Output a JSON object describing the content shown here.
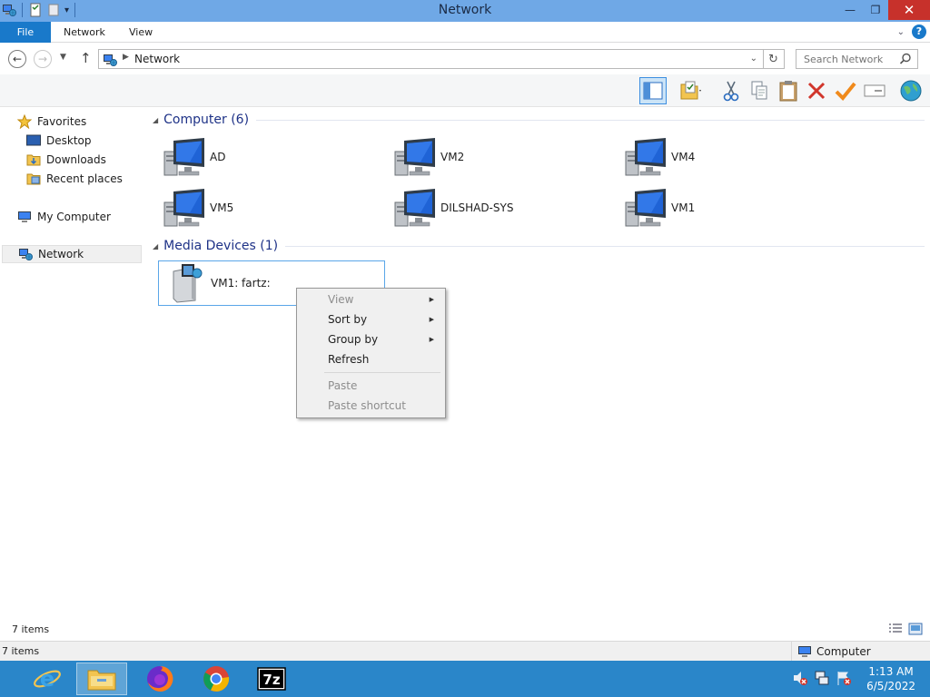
{
  "window": {
    "title": "Network"
  },
  "ribbon": {
    "tabs": [
      "File",
      "Network",
      "View"
    ]
  },
  "navbar": {
    "address_crumb": "Network",
    "search_placeholder": "Search Network"
  },
  "toolbar": {
    "buttons": [
      "preview-pane",
      "properties-folder",
      "cut",
      "copy",
      "paste",
      "delete",
      "apply",
      "rename",
      "network-globe"
    ]
  },
  "navpane": {
    "favorites": "Favorites",
    "favorites_items": [
      "Desktop",
      "Downloads",
      "Recent places"
    ],
    "my_computer": "My Computer",
    "network": "Network"
  },
  "content": {
    "groups": [
      {
        "header": "Computer (6)",
        "items": [
          "AD",
          "VM2",
          "VM4",
          "VM5",
          "DILSHAD-SYS",
          "VM1"
        ]
      },
      {
        "header": "Media Devices (1)",
        "items": [
          "VM1: fartz:"
        ]
      }
    ]
  },
  "context_menu": {
    "items": [
      {
        "label": "View",
        "enabled": false,
        "submenu": true
      },
      {
        "label": "Sort by",
        "enabled": true,
        "submenu": true
      },
      {
        "label": "Group by",
        "enabled": true,
        "submenu": true
      },
      {
        "label": "Refresh",
        "enabled": true,
        "submenu": false
      },
      {
        "label": "Paste",
        "enabled": false,
        "submenu": false
      },
      {
        "label": "Paste shortcut",
        "enabled": false,
        "submenu": false
      }
    ]
  },
  "statusbar": {
    "item_count": "7 items",
    "bottom_count": "7 items",
    "zone": "Computer"
  },
  "taskbar": {
    "apps": [
      "internet-explorer",
      "file-explorer",
      "firefox",
      "chrome",
      "7-zip"
    ],
    "clock_time": "1:13 AM",
    "clock_date": "6/5/2022"
  },
  "colors": {
    "title_bar": "#6fa8e6",
    "file_tab": "#1979ca",
    "taskbar": "#2a86c9",
    "group_header": "#1e3287",
    "close_button": "#c7312b"
  }
}
